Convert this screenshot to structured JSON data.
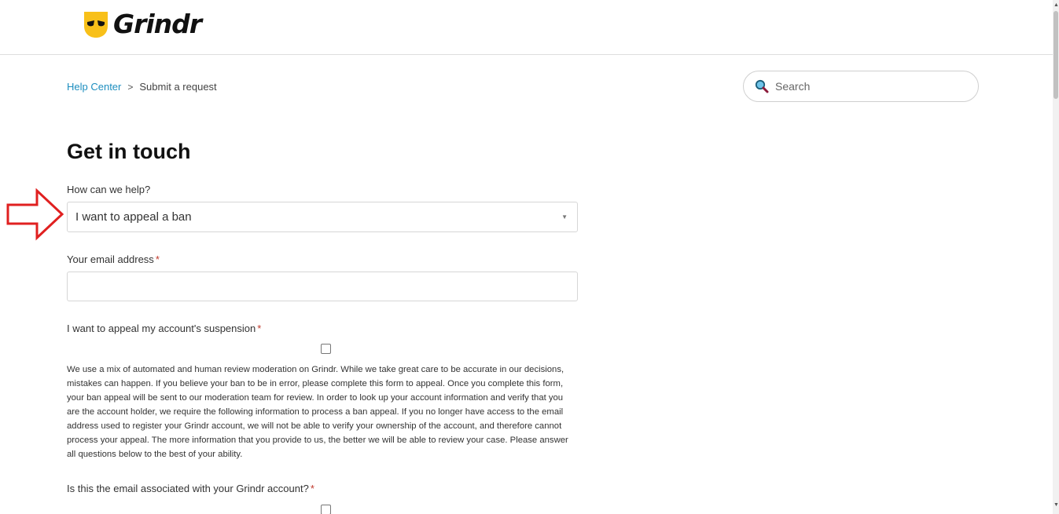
{
  "header": {
    "brand": "Grindr",
    "logo_color": "#f8c019"
  },
  "breadcrumb": {
    "home": "Help Center",
    "separator": ">",
    "current": "Submit a request"
  },
  "search": {
    "placeholder": "Search"
  },
  "form": {
    "title": "Get in touch",
    "help_label": "How can we help?",
    "help_selected": "I want to appeal a ban",
    "email_label": "Your email address",
    "required_mark": "*",
    "appeal_label": "I want to appeal my account's suspension",
    "appeal_checked": false,
    "description": "We use a mix of automated and human review moderation on Grindr. While we take great care to be accurate in our decisions, mistakes can happen. If you believe your ban to be in error, please complete this form to appeal. Once you complete this form, your ban appeal will be sent to our moderation team for review. In order to look up your account information and verify that you are the account holder, we require the following information to process a ban appeal. If you no longer have access to the email address used to register your Grindr account, we will not be able to verify your ownership of the account, and therefore cannot process your appeal. The more information that you provide to us, the better we will be able to review your case. Please answer all questions below to the best of your ability.",
    "associated_label": "Is this the email associated with your Grindr account?",
    "associated_checked": false
  },
  "colors": {
    "link": "#1d8ebf",
    "required": "#c0392b",
    "annotation_arrow": "#e02020"
  }
}
